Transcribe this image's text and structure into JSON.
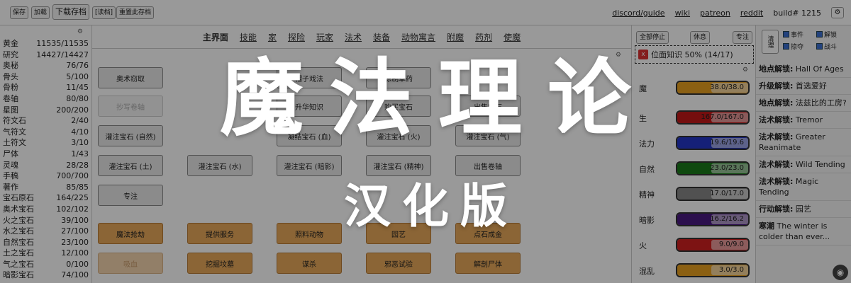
{
  "toolbar": {
    "save": "保存",
    "load": "加载",
    "download": "下载存档",
    "read": "[读档]",
    "reset": "重置此存档"
  },
  "top_links": {
    "discord": "discord/guide",
    "wiki": "wiki",
    "patreon": "patreon",
    "reddit": "reddit",
    "build": "build# 1215",
    "settings_icon": "gear-icon"
  },
  "resources": [
    {
      "name": "黄金",
      "value": "11535/11535"
    },
    {
      "name": "研究",
      "value": "14427/14427"
    },
    {
      "name": "奥秘",
      "value": "76/76"
    },
    {
      "name": "骨头",
      "value": "5/100"
    },
    {
      "name": "骨粉",
      "value": "11/45"
    },
    {
      "name": "卷轴",
      "value": "80/80"
    },
    {
      "name": "星图",
      "value": "200/200"
    },
    {
      "name": "符文石",
      "value": "2/40"
    },
    {
      "name": "气符文",
      "value": "4/10"
    },
    {
      "name": "土符文",
      "value": "3/10"
    },
    {
      "name": "尸体",
      "value": "1/43"
    },
    {
      "name": "灵魂",
      "value": "28/28"
    },
    {
      "name": "手稿",
      "value": "700/700"
    },
    {
      "name": "著作",
      "value": "85/85"
    },
    {
      "name": "宝石原石",
      "value": "164/225"
    },
    {
      "name": "奥术宝石",
      "value": "102/102"
    },
    {
      "name": "火之宝石",
      "value": "39/100"
    },
    {
      "name": "水之宝石",
      "value": "27/100"
    },
    {
      "name": "自然宝石",
      "value": "23/100"
    },
    {
      "name": "土之宝石",
      "value": "12/100"
    },
    {
      "name": "气之宝石",
      "value": "0/100"
    },
    {
      "name": "暗影宝石",
      "value": "74/100"
    }
  ],
  "tabs": [
    "主界面",
    "技能",
    "家",
    "探险",
    "玩家",
    "法术",
    "装备",
    "动物寓言",
    "附魔",
    "药剂",
    "使魔"
  ],
  "actions": {
    "row1": [
      "奥术窃取",
      "",
      "帽子戏法",
      "炼制草药",
      "",
      ""
    ],
    "row2": [
      "抄写卷轴",
      "",
      "升华知识",
      "购买宝石",
      "出售宝石"
    ],
    "row3": [
      "灌注宝石 (自然)",
      "",
      "凝结宝石 (血)",
      "灌注宝石 (火)",
      "灌注宝石 (气)"
    ],
    "row4": [
      "灌注宝石 (土)",
      "灌注宝石 (水)",
      "灌注宝石 (暗影)",
      "灌注宝石 (精神)",
      "出售卷轴"
    ],
    "row5": [
      "专注"
    ],
    "orange1": [
      "魔法抢劫",
      "提供服务",
      "照料动物",
      "园艺",
      "点石成金"
    ],
    "orange2": [
      "吸血",
      "挖掘坟墓",
      "谋杀",
      "邪恶试验",
      "解剖尸体"
    ]
  },
  "right_panel": {
    "stop_all": "全部停止",
    "rest": "休息",
    "focus": "专注",
    "task_close": "x",
    "task_label": "位面知识 50% (14/17)"
  },
  "stats": [
    {
      "name": "魔",
      "value": "38.0/38.0",
      "fill": 1.0,
      "color": "#e8a020"
    },
    {
      "name": "生",
      "value": "167.0/167.0",
      "fill": 1.0,
      "color": "#c41818"
    },
    {
      "name": "法力",
      "value": "19.6/19.6",
      "fill": 1.0,
      "color": "#2436c8"
    },
    {
      "name": "自然",
      "value": "23.0/23.0",
      "fill": 1.0,
      "color": "#1a7a1a"
    },
    {
      "name": "精神",
      "value": "17.0/17.0",
      "fill": 1.0,
      "color": "#888888"
    },
    {
      "name": "暗影",
      "value": "16.2/16.2",
      "fill": 1.0,
      "color": "#4a1a80"
    },
    {
      "name": "火",
      "value": "9.0/9.0",
      "fill": 1.0,
      "color": "#d02020"
    },
    {
      "name": "混乱",
      "value": "3.0/3.0",
      "fill": 1.0,
      "color": "#e8a020"
    }
  ],
  "log_panel": {
    "clear": "清理",
    "filters": [
      "事件",
      "解锁",
      "掠夺",
      "战斗"
    ],
    "entries": [
      {
        "title": "地点解锁:",
        "text": "Hall Of Ages"
      },
      {
        "title": "升级解锁:",
        "text": "首选爱好"
      },
      {
        "title": "地点解锁:",
        "text": "法兹比的工房?"
      },
      {
        "title": "法术解锁:",
        "text": "Tremor"
      },
      {
        "title": "法术解锁:",
        "text": "Greater Reanimate"
      },
      {
        "title": "法术解锁:",
        "text": "Wild Tending"
      },
      {
        "title": "法术解锁:",
        "text": "Magic Tending"
      },
      {
        "title": "行动解锁:",
        "text": "园艺"
      },
      {
        "title": "寒潮",
        "text": "The winter is colder than ever..."
      }
    ]
  },
  "banner": {
    "title": "魔法理论",
    "subtitle": "汉化版"
  }
}
